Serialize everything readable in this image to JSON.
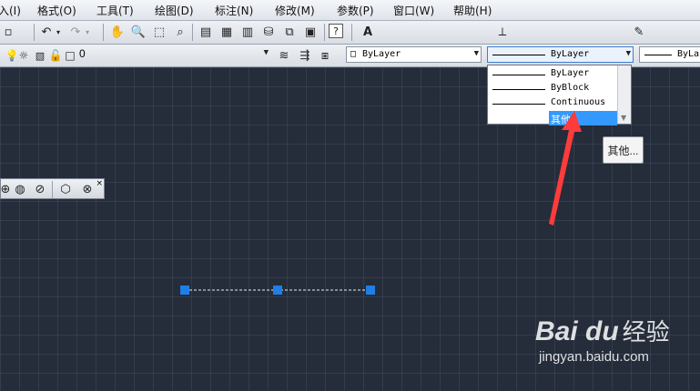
{
  "menu": [
    "入(I)",
    "格式(O)",
    "工具(T)",
    "绘图(D)",
    "标注(N)",
    "修改(M)",
    "参数(P)",
    "窗口(W)",
    "帮助(H)"
  ],
  "toolbar1": {
    "help_glyph": "?"
  },
  "layer": {
    "name": "0"
  },
  "properties": {
    "color_label": "ByLayer",
    "linetype_label": "ByLayer",
    "lineweight_label": "ByLa"
  },
  "linetype_dropdown": {
    "items": [
      "ByLayer",
      "ByBlock",
      "Continuous",
      "其他..."
    ],
    "selected_index": 3
  },
  "tooltip": "其他...",
  "colors": {
    "canvas": "#252c3a",
    "grip": "#1e7fe6",
    "selection": "#3399ff",
    "arrow": "#ff3b3b"
  },
  "watermark": {
    "logo": "Bai du",
    "text": "经验",
    "url": "jingyan.baidu.com"
  }
}
